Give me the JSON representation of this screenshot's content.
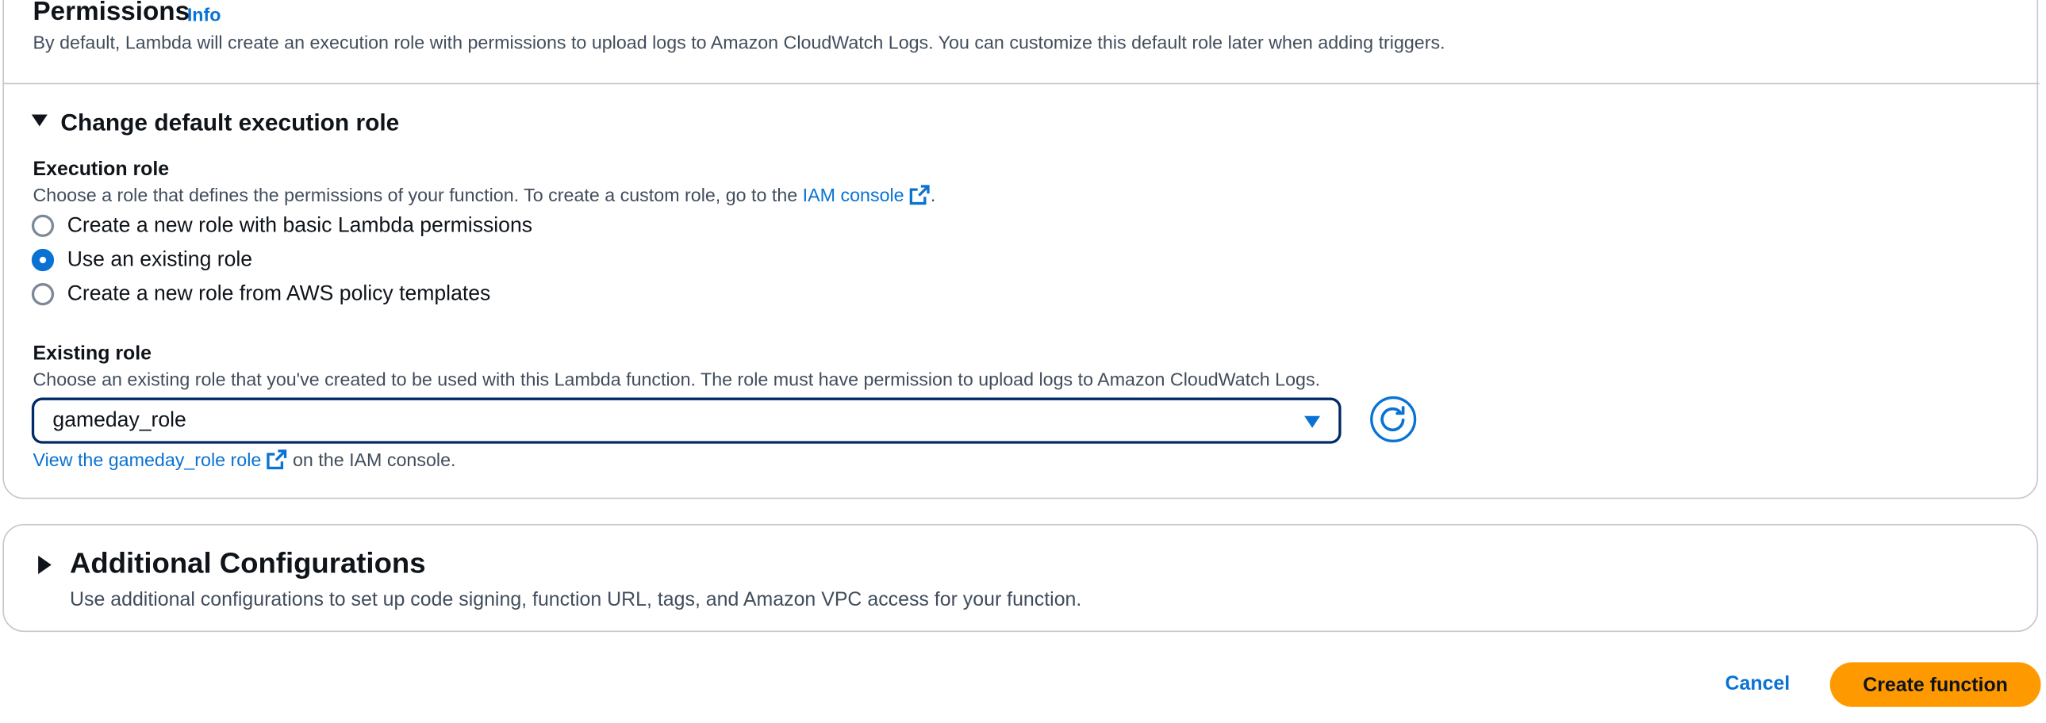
{
  "permissions": {
    "title": "Permissions",
    "info_link": "Info",
    "description": "By default, Lambda will create an execution role with permissions to upload logs to Amazon CloudWatch Logs. You can customize this default role later when adding triggers."
  },
  "change_role": {
    "title": "Change default execution role",
    "expanded": true,
    "execution_role": {
      "label": "Execution role",
      "description_prefix": "Choose a role that defines the permissions of your function. To create a custom role, go to the",
      "iam_console_link": "IAM console",
      "description_suffix": ".",
      "options": [
        {
          "label": "Create a new role with basic Lambda permissions",
          "selected": false
        },
        {
          "label": "Use an existing role",
          "selected": true
        },
        {
          "label": "Create a new role from AWS policy templates",
          "selected": false
        }
      ]
    },
    "existing_role": {
      "label": "Existing role",
      "description": "Choose an existing role that you've created to be used with this Lambda function. The role must have permission to upload logs to Amazon CloudWatch Logs.",
      "selected_value": "gameday_role",
      "view_link": "View the gameday_role role",
      "view_suffix": "on the IAM console."
    }
  },
  "additional": {
    "title": "Additional Configurations",
    "expanded": false,
    "description": "Use additional configurations to set up code signing, function URL, tags, and Amazon VPC access for your function."
  },
  "footer": {
    "cancel_label": "Cancel",
    "create_label": "Create function"
  },
  "colors": {
    "link": "#0972d3",
    "primary_button": "#ff9900",
    "select_border": "#002b66",
    "panel_border": "#c6c6cd",
    "text": "#0f141a",
    "secondary_text": "#414d5c"
  },
  "icons": {
    "external_link": "external-link-icon",
    "refresh": "refresh-icon",
    "caret_down": "caret-down-icon",
    "caret_right": "caret-right-icon"
  }
}
